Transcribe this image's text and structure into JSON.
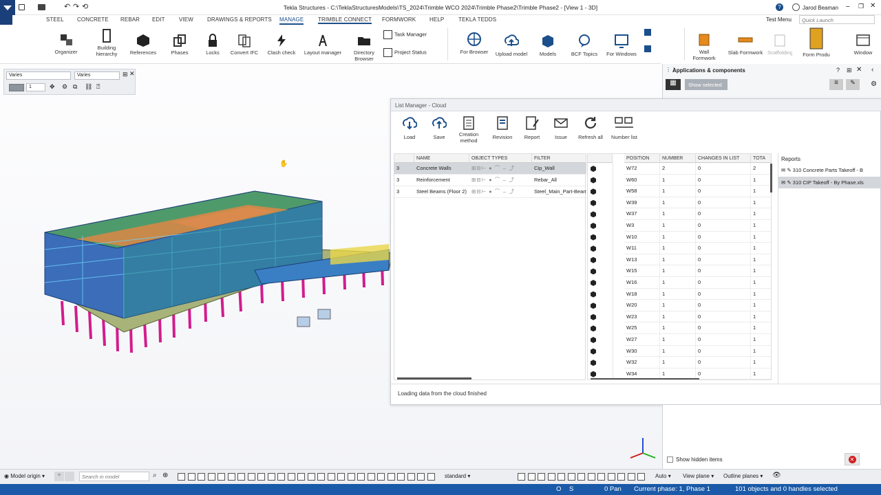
{
  "window": {
    "title": "Tekla Structures - C:\\TeklaStructuresModels\\TS_2024\\Trimble WCO 2024\\Trimble Phase2\\Trimble Phase2 - [View 1 - 3D]",
    "user": "Jarod Beaman",
    "test_menu": "Test Menu",
    "quick_launch_placeholder": "Quick Launch"
  },
  "menu": [
    "STEEL",
    "CONCRETE",
    "REBAR",
    "EDIT",
    "VIEW",
    "DRAWINGS & REPORTS",
    "MANAGE",
    "TRIMBLE CONNECT",
    "FORMWORK",
    "HELP",
    "TEKLA TEDDS"
  ],
  "menu_active": "MANAGE",
  "ribbon": [
    {
      "label": "Organizer",
      "icon": "organizer-icon"
    },
    {
      "label": "Building hierarchy",
      "icon": "building-hierarchy-icon"
    },
    {
      "label": "References",
      "icon": "references-icon"
    },
    {
      "label": "Phases",
      "icon": "phases-icon"
    },
    {
      "label": "Locks",
      "icon": "lock-icon"
    },
    {
      "label": "Convert IFC",
      "icon": "convert-ifc-icon"
    },
    {
      "label": "Clash check",
      "icon": "clash-check-icon"
    },
    {
      "label": "Layout manager",
      "icon": "layout-manager-icon"
    },
    {
      "label": "Directory Browser",
      "icon": "directory-browser-icon"
    }
  ],
  "ribbon_small": [
    "Task Manager",
    "Project Status"
  ],
  "ribbon_connect": [
    {
      "label": "For Browser",
      "icon": "globe-icon"
    },
    {
      "label": "Upload model",
      "icon": "upload-icon"
    },
    {
      "label": "Models",
      "icon": "models-icon"
    },
    {
      "label": "BCF Topics",
      "icon": "bcf-icon"
    },
    {
      "label": "For Windows",
      "icon": "windows-sync-icon"
    }
  ],
  "ribbon_formwork": [
    {
      "label": "Wall Formwork",
      "icon": "wall-formwork-icon"
    },
    {
      "label": "Slab Formwork",
      "icon": "slab-formwork-icon"
    },
    {
      "label": "Scaffolding",
      "icon": "scaffolding-icon"
    },
    {
      "label": "Form Produ",
      "icon": "form-product-icon"
    },
    {
      "label": "Window",
      "icon": "window-icon"
    }
  ],
  "props": {
    "class_a": "Varies",
    "class_b": "Varies",
    "num": "1"
  },
  "apps_panel": {
    "title": "Applications & components",
    "search_placeholder": "Show selected"
  },
  "list_manager": {
    "title": "List Manager - Cloud",
    "toolbar": [
      "Load",
      "Save",
      "Creation method",
      "Revision",
      "Report",
      "Issue",
      "Refresh all",
      "Number list"
    ],
    "left_headers": [
      "NAME",
      "OBJECT TYPES",
      "FILTER"
    ],
    "lists": [
      {
        "idx": "3",
        "name": "Concrete Walls",
        "filter": "Cip_Wall"
      },
      {
        "idx": "3",
        "name": "Reinforcement",
        "filter": "Rebar_All"
      },
      {
        "idx": "3",
        "name": "Steel Beams (Floor 2)",
        "filter": "Steel_Main_Part-Beam"
      }
    ],
    "right_headers": [
      "POSITION",
      "NUMBER",
      "CHANGES IN LIST",
      "TOTA"
    ],
    "rows": [
      [
        "W72",
        "2",
        "0",
        "2"
      ],
      [
        "W60",
        "1",
        "0",
        "1"
      ],
      [
        "W58",
        "1",
        "0",
        "1"
      ],
      [
        "W39",
        "1",
        "0",
        "1"
      ],
      [
        "W37",
        "1",
        "0",
        "1"
      ],
      [
        "W3",
        "1",
        "0",
        "1"
      ],
      [
        "W10",
        "1",
        "0",
        "1"
      ],
      [
        "W11",
        "1",
        "0",
        "1"
      ],
      [
        "W13",
        "1",
        "0",
        "1"
      ],
      [
        "W15",
        "1",
        "0",
        "1"
      ],
      [
        "W16",
        "1",
        "0",
        "1"
      ],
      [
        "W18",
        "1",
        "0",
        "1"
      ],
      [
        "W20",
        "1",
        "0",
        "1"
      ],
      [
        "W23",
        "1",
        "0",
        "1"
      ],
      [
        "W25",
        "1",
        "0",
        "1"
      ],
      [
        "W27",
        "1",
        "0",
        "1"
      ],
      [
        "W30",
        "1",
        "0",
        "1"
      ],
      [
        "W32",
        "1",
        "0",
        "1"
      ],
      [
        "W34",
        "1",
        "0",
        "1"
      ]
    ],
    "reports_title": "Reports",
    "reports": [
      "310  Concrete Parts Takeoff - B",
      "310  CIP Takeoff - By Phase.xls"
    ],
    "status": "Loading data from the cloud finished"
  },
  "show_hidden": "Show hidden items",
  "bottom": {
    "model_origin": "Model origin",
    "search_placeholder": "Search in model",
    "standard": "standard",
    "auto": "Auto",
    "view_plane": "View plane",
    "outline_planes": "Outline planes"
  },
  "status": {
    "o": "O",
    "s": "S",
    "pan": "0 Pan",
    "phase": "Current phase: 1, Phase 1",
    "selected": "101 objects and 0 handles selected"
  },
  "colors": {
    "brand": "#1b3f7a",
    "status": "#1a5aa8",
    "accent": "#1b4f8b"
  }
}
